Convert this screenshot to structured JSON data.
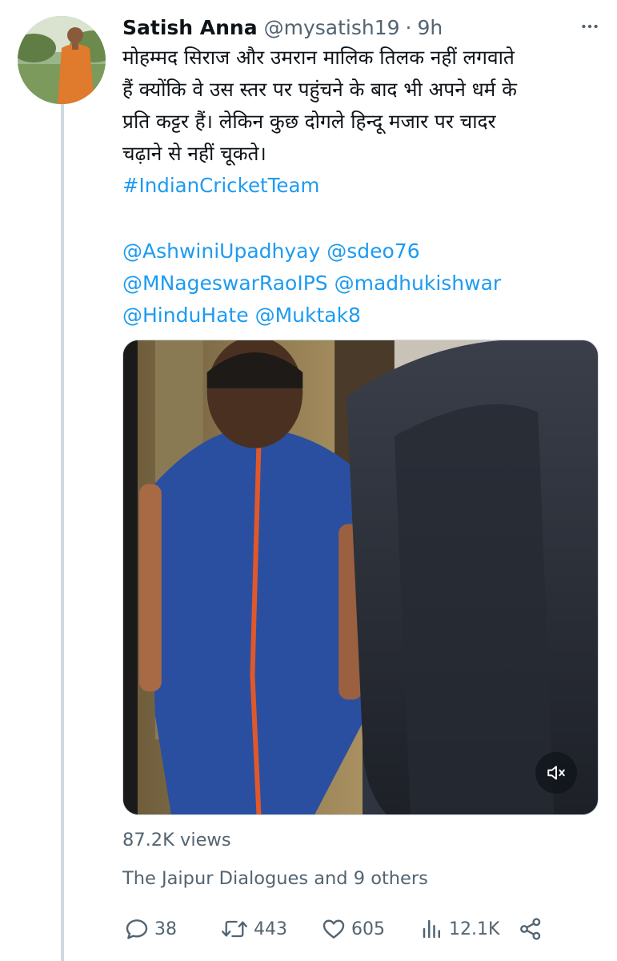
{
  "tweet": {
    "author": {
      "display_name": "Satish Anna",
      "handle": "@mysatish19",
      "separator": "·",
      "time": "9h"
    },
    "text_lines": [
      "मोहम्मद सिराज और उमरान मालिक तिलक नहीं लगवाते",
      "हैं क्योंकि वे उस स्तर पर पहुंचने के बाद भी अपने धर्म के",
      "प्रति कट्टर हैं। लेकिन कुछ दोगले हिन्दू मजार पर चादर",
      "चढ़ाने से नहीं चूकते।"
    ],
    "hashtag": "#IndianCricketTeam",
    "mentions": [
      [
        "@AshwiniUpadhyay",
        "@sdeo76"
      ],
      [
        "@MNageswarRaoIPS",
        "@madhukishwar"
      ],
      [
        "@HinduHate",
        "@Muktak8"
      ]
    ],
    "media": {
      "type": "video",
      "muted": true,
      "mute_icon": "speaker-muted-icon"
    },
    "views": "87.2K views",
    "social_context": "The Jaipur Dialogues and 9 others",
    "actions": {
      "replies": "38",
      "retweets": "443",
      "likes": "605",
      "analytics": "12.1K"
    }
  },
  "colors": {
    "link": "#1d9bf0",
    "text": "#0f1419",
    "secondary": "#536471",
    "thread_line": "#cfd9de"
  }
}
